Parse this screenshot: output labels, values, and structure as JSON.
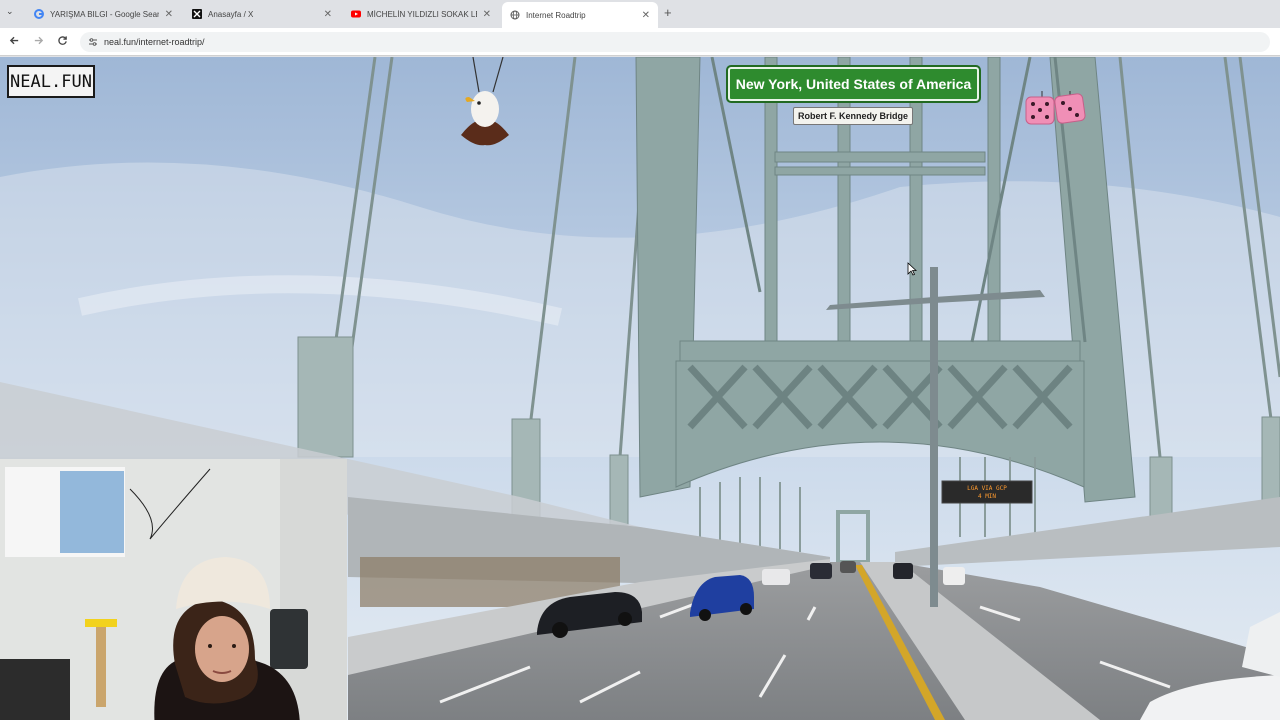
{
  "browser": {
    "tabs": [
      {
        "title": "YARIŞMA BILGI - Google Search",
        "icon": "google-icon",
        "active": false
      },
      {
        "title": "Anasayfa / X",
        "icon": "x-icon",
        "active": false
      },
      {
        "title": "MİCHELİN YILDIZLI SOKAK LEZZ",
        "icon": "youtube-icon",
        "active": false
      },
      {
        "title": "Internet Roadtrip",
        "icon": "globe-icon",
        "active": true
      }
    ],
    "close_glyph": "✕",
    "new_tab_glyph": "+",
    "menu_glyph": "⌄",
    "url": "neal.fun/internet-roadtrip/"
  },
  "site": {
    "logo": "NEAL.FUN",
    "location": "New York, United States of America",
    "street": "Robert F. Kennedy Bridge"
  },
  "scene": {
    "vms_sign_line1": "LGA VIA GCP",
    "vms_sign_line2": "4 MIN"
  },
  "colors": {
    "sign_green": "#2e8b2e",
    "bridge_steel": "#8fa6a4",
    "dice_pink": "#f08fb6"
  }
}
